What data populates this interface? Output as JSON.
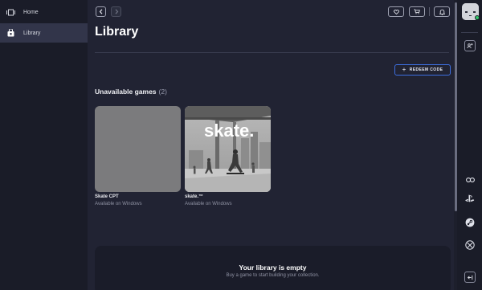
{
  "sidebar": {
    "items": [
      {
        "label": "Home",
        "icon": "carousel-icon"
      },
      {
        "label": "Library",
        "icon": "library-bag-icon"
      }
    ]
  },
  "header": {
    "wishlist_icon": "heart-icon",
    "cart_icon": "cart-icon",
    "notifications_icon": "bell-icon"
  },
  "main": {
    "title": "Library",
    "redeem_label": "REDEEM CODE",
    "section": {
      "title": "Unavailable games",
      "count": "(2)"
    },
    "games": [
      {
        "name": "Skate CPT",
        "platform": "Available on Windows"
      },
      {
        "name": "skate.™",
        "platform": "Available on Windows",
        "cover_text": "skate."
      }
    ],
    "empty": {
      "title": "Your library is empty",
      "subtitle": "Buy a game to start building your collection."
    }
  },
  "rail": {
    "icons": [
      "avatar",
      "friend-add-icon",
      "link-icon",
      "playstation-icon",
      "steam-icon",
      "xbox-icon",
      "collapse-panel-icon"
    ],
    "status_color": "#33c46a"
  },
  "colors": {
    "accent": "#3d6fe0",
    "background": "#212333",
    "sidebar": "#1a1c28"
  }
}
